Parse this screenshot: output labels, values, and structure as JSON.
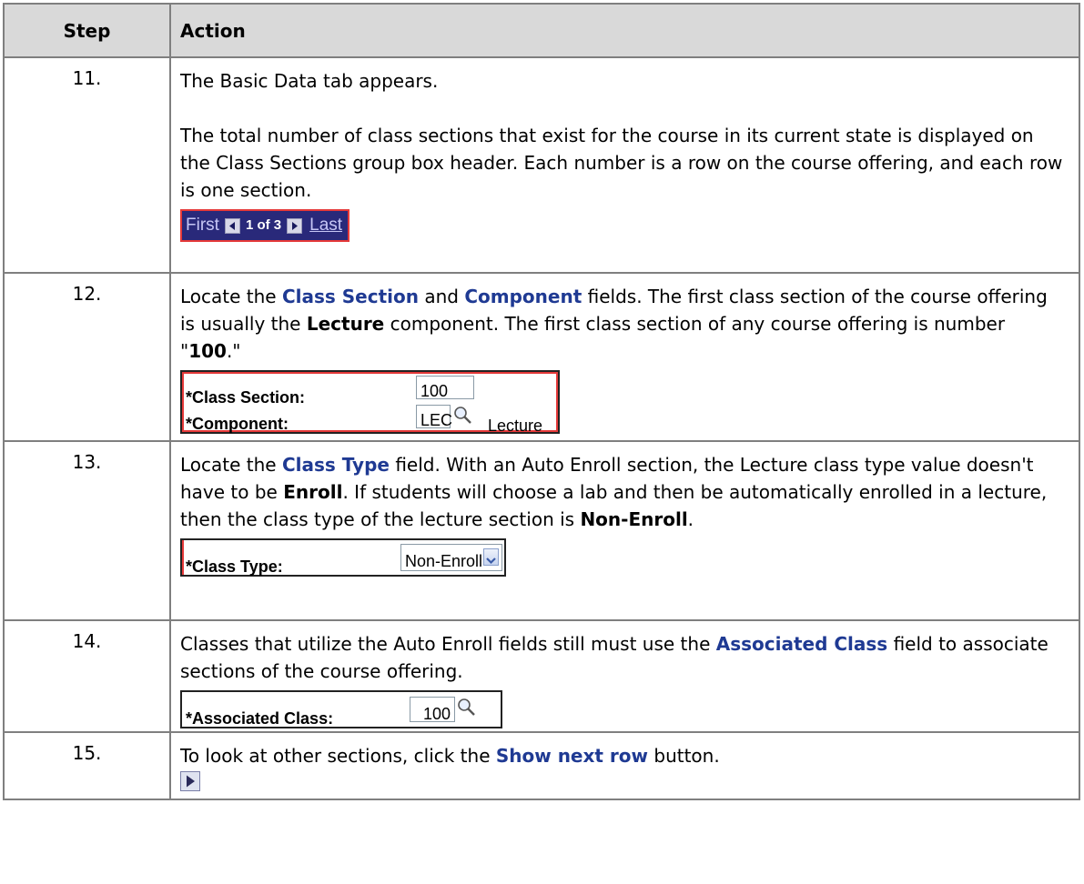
{
  "header": {
    "step": "Step",
    "action": "Action"
  },
  "steps": [
    {
      "num": "11.",
      "p1": "The Basic Data tab appears.",
      "p2": "The total number of class sections that exist for the course in its current state is displayed on the Class Sections group box header. Each number is a row on the course offering, and each row is one section.",
      "nav": {
        "first": "First",
        "count": "1 of 3",
        "last": "Last"
      }
    },
    {
      "num": "12.",
      "t1": "Locate the ",
      "b1": "Class Section",
      "t2": " and ",
      "b2": "Component",
      "t3": " fields.  The first class section of the course offering is usually the ",
      "b3": "Lecture",
      "t4": " component.  The first class section of any course offering is number \"",
      "b4": "100",
      "t5": ".\"",
      "fields": {
        "class_section_label": "*Class Section:",
        "class_section_value": "100",
        "component_label": "*Component:",
        "component_value": "LEC",
        "component_desc": "Lecture"
      }
    },
    {
      "num": "13.",
      "t1": "Locate the ",
      "b1": "Class Type",
      "t2": " field.  With an Auto Enroll section, the Lecture class type value doesn't have to be ",
      "b2": "Enroll",
      "t3": ". If students will choose a lab and then be automatically enrolled in a lecture, then the class type of the lecture section is ",
      "b3": "Non-Enroll",
      "t4": ".",
      "fields": {
        "class_type_label": "*Class Type:",
        "class_type_value": "Non-Enroll"
      }
    },
    {
      "num": "14.",
      "t1": "Classes that utilize the Auto Enroll fields still must use the ",
      "b1": "Associated Class",
      "t2": " field to associate sections of the course offering.",
      "fields": {
        "assoc_label": "*Associated Class:",
        "assoc_value": "100"
      }
    },
    {
      "num": "15.",
      "t1": "To look at other sections, click the ",
      "b1": "Show next row",
      "t2": " button."
    }
  ],
  "colors": {
    "nav_bg": "#29297a",
    "highlight": "#e53939",
    "link_blue": "#1f3a93",
    "header_bg": "#d9d9d9"
  },
  "icons": [
    "prev-arrow-icon",
    "next-arrow-icon",
    "magnifier-icon",
    "dropdown-arrow-icon",
    "show-next-row-icon"
  ]
}
